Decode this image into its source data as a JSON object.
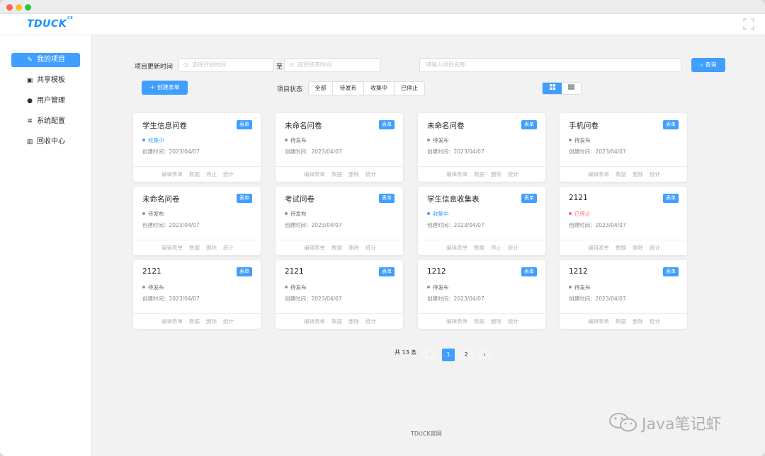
{
  "app": {
    "logo": "TDUCK",
    "logo_sup": "CE"
  },
  "sidebar": {
    "items": [
      {
        "icon": "edit-icon",
        "label": "我的项目",
        "active": true
      },
      {
        "icon": "template-icon",
        "label": "共享模板",
        "active": false
      },
      {
        "icon": "user-icon",
        "label": "用户管理",
        "active": false
      },
      {
        "icon": "gear-icon",
        "label": "系统配置",
        "active": false
      },
      {
        "icon": "trash-icon",
        "label": "回收中心",
        "active": false
      }
    ]
  },
  "filters": {
    "update_time_label": "项目更新时间",
    "start_placeholder": "选择开始时间",
    "to_label": "至",
    "end_placeholder": "选择结束时间",
    "name_placeholder": "请输入项目名称",
    "search_button": "查询",
    "create_button": "创建表单",
    "status_label": "项目状态",
    "status_options": [
      "全部",
      "待发布",
      "收集中",
      "已停止"
    ]
  },
  "colors": {
    "accent": "#409eff",
    "collecting": "#409eff",
    "pending": "#909399",
    "stopped": "#f56c6c"
  },
  "cards": [
    {
      "title": "学生信息问卷",
      "tag": "表单",
      "status": "收集中",
      "status_type": "collecting",
      "created": "创建时间：2023/04/07",
      "actions": [
        "编辑表单",
        "数据",
        "停止",
        "统计"
      ]
    },
    {
      "title": "未命名问卷",
      "tag": "表单",
      "status": "待发布",
      "status_type": "pending",
      "created": "创建时间：2023/04/07",
      "actions": [
        "编辑表单",
        "数据",
        "删除",
        "统计"
      ]
    },
    {
      "title": "未命名问卷",
      "tag": "表单",
      "status": "待发布",
      "status_type": "pending",
      "created": "创建时间：2023/04/07",
      "actions": [
        "编辑表单",
        "数据",
        "删除",
        "统计"
      ]
    },
    {
      "title": "手机问卷",
      "tag": "表单",
      "status": "待发布",
      "status_type": "pending",
      "created": "创建时间：2023/04/07",
      "actions": [
        "编辑表单",
        "数据",
        "删除",
        "统计"
      ]
    },
    {
      "title": "未命名问卷",
      "tag": "表单",
      "status": "待发布",
      "status_type": "pending",
      "created": "创建时间：2023/04/07",
      "actions": [
        "编辑表单",
        "数据",
        "删除",
        "统计"
      ]
    },
    {
      "title": "考试问卷",
      "tag": "表单",
      "status": "待发布",
      "status_type": "pending",
      "created": "创建时间：2023/04/07",
      "actions": [
        "编辑表单",
        "数据",
        "删除",
        "统计"
      ]
    },
    {
      "title": "学生信息收集表",
      "tag": "表单",
      "status": "收集中",
      "status_type": "collecting",
      "created": "创建时间：2023/04/07",
      "actions": [
        "编辑表单",
        "数据",
        "停止",
        "统计"
      ]
    },
    {
      "title": "2121",
      "tag": "表单",
      "status": "已停止",
      "status_type": "stopped",
      "created": "创建时间：2023/04/07",
      "actions": [
        "编辑表单",
        "数据",
        "删除",
        "统计"
      ]
    },
    {
      "title": "2121",
      "tag": "表单",
      "status": "待发布",
      "status_type": "pending",
      "created": "创建时间：2023/04/07",
      "actions": [
        "编辑表单",
        "数据",
        "删除",
        "统计"
      ]
    },
    {
      "title": "2121",
      "tag": "表单",
      "status": "待发布",
      "status_type": "pending",
      "created": "创建时间：2023/04/07",
      "actions": [
        "编辑表单",
        "数据",
        "删除",
        "统计"
      ]
    },
    {
      "title": "1212",
      "tag": "表单",
      "status": "待发布",
      "status_type": "pending",
      "created": "创建时间：2023/04/07",
      "actions": [
        "编辑表单",
        "数据",
        "删除",
        "统计"
      ]
    },
    {
      "title": "1212",
      "tag": "表单",
      "status": "待发布",
      "status_type": "pending",
      "created": "创建时间：2023/04/07",
      "actions": [
        "编辑表单",
        "数据",
        "删除",
        "统计"
      ]
    }
  ],
  "pagination": {
    "total": "共 13 条",
    "pages": [
      "1",
      "2"
    ],
    "current": "1",
    "prev": "‹",
    "next": "›"
  },
  "footer": {
    "link": "TDUCK官网"
  },
  "watermark": {
    "text": "Java笔记虾"
  }
}
